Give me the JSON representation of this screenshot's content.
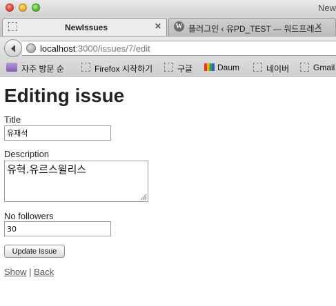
{
  "window": {
    "title_visible": "New"
  },
  "tabs": [
    {
      "label": "NewIssues",
      "active": true,
      "icon": "blank-page-icon"
    },
    {
      "label": "플러그인 ‹ 유PD_TEST — 워드프레스",
      "active": false,
      "icon": "wordpress-icon"
    }
  ],
  "tab_close_symbol": "✕",
  "nav": {
    "url_host": "localhost",
    "url_path": ":3000/issues/7/edit"
  },
  "bookmarks": [
    {
      "label": "자주 방문 순",
      "icon": "most-visited-icon"
    },
    {
      "label": "Firefox 시작하기",
      "icon": "blank-page-icon"
    },
    {
      "label": "구글",
      "icon": "blank-page-icon"
    },
    {
      "label": "Daum",
      "icon": "daum-icon"
    },
    {
      "label": "네이버",
      "icon": "blank-page-icon"
    },
    {
      "label": "Gmail",
      "icon": "blank-page-icon"
    }
  ],
  "page": {
    "heading": "Editing issue",
    "title_label": "Title",
    "title_value": "유재석",
    "description_label": "Description",
    "description_value": "유혁.유르스윌리스",
    "followers_label": "No followers",
    "followers_value": "30",
    "submit_label": "Update Issue",
    "show_link": "Show",
    "separator": "|",
    "back_link": "Back"
  }
}
